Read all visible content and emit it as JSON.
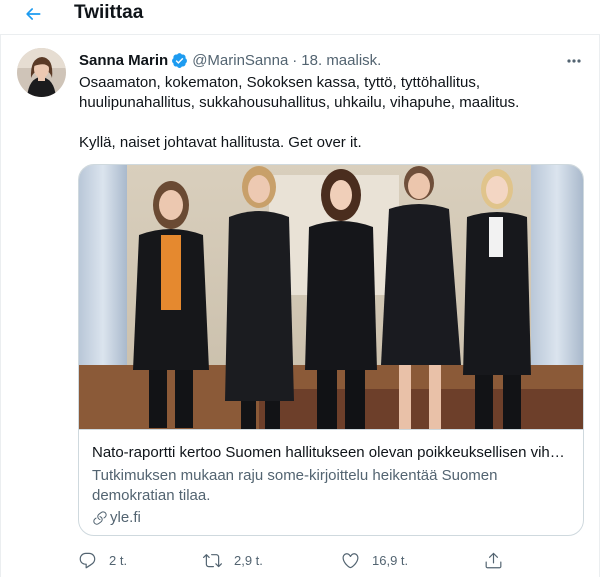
{
  "header": {
    "title": "Twiittaa",
    "back_icon": "arrow-left-icon"
  },
  "tweet": {
    "author": {
      "name": "Sanna Marin",
      "handle": "@MarinSanna",
      "verified": true
    },
    "date": "18. maalisk.",
    "separator": "·",
    "text_line1": "Osaamaton, kokematon, Sokoksen kassa, tyttö, tyttöhallitus,",
    "text_line2": "huulipunahallitus, sukkahousuhallitus, uhkailu, vihapuhe, maalitus.",
    "text_line3": "Kyllä, naiset johtavat hallitusta. Get over it.",
    "card": {
      "title": "Nato-raportti kertoo Suomen hallitukseen olevan poikkeuksellisen vihamielisen",
      "description": "Tutkimuksen mukaan raju some-kirjoittelu heikentää Suomen demokratian tilaa.",
      "domain": "yle.fi"
    },
    "actions": {
      "reply_count": "2 t.",
      "retweet_count": "2,9 t.",
      "like_count": "16,9 t."
    }
  },
  "colors": {
    "accent": "#1d9bf0",
    "text": "#0f1419",
    "secondary": "#536471",
    "border": "#cfd9de"
  }
}
